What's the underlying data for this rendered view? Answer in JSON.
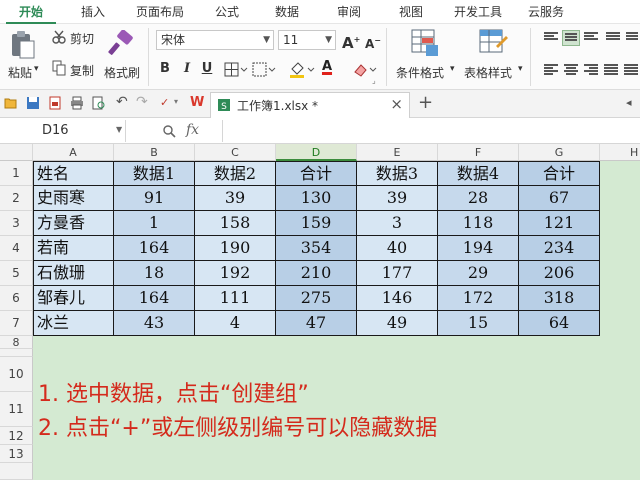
{
  "menu_tabs": [
    "开始",
    "插入",
    "页面布局",
    "公式",
    "数据",
    "审阅",
    "视图",
    "开发工具",
    "云服务"
  ],
  "ribbon": {
    "paste_label": "粘贴",
    "cut_label": "剪切",
    "copy_label": "复制",
    "format_painter_label": "格式刷",
    "font_name": "宋体",
    "font_size": "11",
    "grow_font": "A",
    "shrink_font": "A",
    "bold": "B",
    "italic": "I",
    "underline": "U",
    "font_color_letter": "A",
    "conditional_format_label": "条件格式",
    "table_style_label": "表格样式"
  },
  "quickbar": {
    "file_tab_label": "工作簿1.xlsx *",
    "close_symbol": "×",
    "new_tab_symbol": "+"
  },
  "formula_bar": {
    "cell_ref": "D16",
    "fx": "fx"
  },
  "sheet": {
    "columns": [
      "A",
      "B",
      "C",
      "D",
      "E",
      "F",
      "G",
      "H"
    ],
    "selected_column": "D",
    "row_numbers": [
      "1",
      "2",
      "3",
      "4",
      "5",
      "6",
      "7",
      "8",
      "10",
      "11",
      "12",
      "13"
    ],
    "rows": [
      [
        "姓名",
        "数据1",
        "数据2",
        "合计",
        "数据3",
        "数据4",
        "合计"
      ],
      [
        "史雨寒",
        "91",
        "39",
        "130",
        "39",
        "28",
        "67"
      ],
      [
        "方曼香",
        "1",
        "158",
        "159",
        "3",
        "118",
        "121"
      ],
      [
        "若南",
        "164",
        "190",
        "354",
        "40",
        "194",
        "234"
      ],
      [
        "石傲珊",
        "18",
        "192",
        "210",
        "177",
        "29",
        "206"
      ],
      [
        "邹春儿",
        "164",
        "111",
        "275",
        "146",
        "172",
        "318"
      ],
      [
        "冰兰",
        "43",
        "4",
        "47",
        "49",
        "15",
        "64"
      ]
    ]
  },
  "notes": [
    "1.  选中数据，点击“创建组”",
    "2.  点击“+”或左侧级别编号可以隐藏数据"
  ],
  "colors": {
    "accent": "#2e8b57",
    "sheet_background": "#d4ead2",
    "note_text": "#d42a1c"
  }
}
